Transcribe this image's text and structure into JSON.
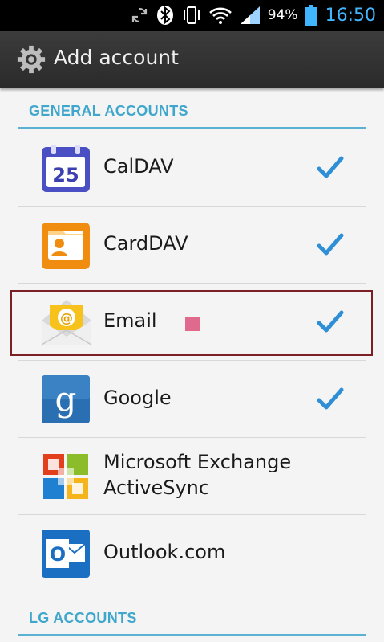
{
  "status_bar": {
    "battery_percent": "94%",
    "time": "16:50",
    "icons": [
      "sync-icon",
      "bluetooth-icon",
      "vibrate-icon",
      "wifi-icon",
      "signal-icon",
      "battery-icon"
    ]
  },
  "title_bar": {
    "title": "Add account",
    "icon": "settings-gear-icon"
  },
  "sections": [
    {
      "header": "GENERAL ACCOUNTS"
    },
    {
      "header": "LG ACCOUNTS"
    }
  ],
  "accounts": [
    {
      "label": "CalDAV",
      "checked": true,
      "icon": "calendar-icon",
      "calendar_day": "25"
    },
    {
      "label": "CardDAV",
      "checked": true,
      "icon": "contact-card-icon"
    },
    {
      "label": "Email",
      "checked": true,
      "icon": "email-envelope-icon",
      "highlighted": true
    },
    {
      "label": "Google",
      "checked": true,
      "icon": "google-icon",
      "icon_letter": "g"
    },
    {
      "label_line1": "Microsoft Exchange",
      "label_line2": "ActiveSync",
      "checked": false,
      "icon": "exchange-icon"
    },
    {
      "label": "Outlook.com",
      "checked": false,
      "icon": "outlook-icon",
      "icon_letter": "O"
    }
  ],
  "colors": {
    "accent": "#3fa6cc",
    "check": "#2f8fd6",
    "highlight_border": "#7a1f23",
    "time": "#3fb6ff"
  }
}
